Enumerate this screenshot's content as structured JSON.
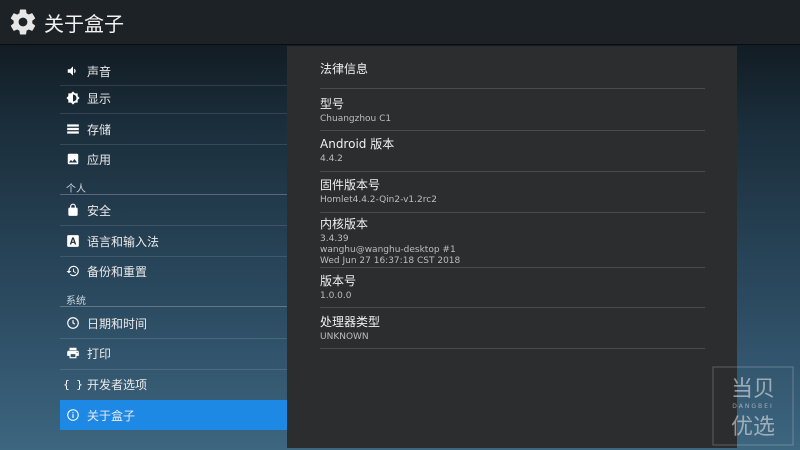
{
  "titlebar": {
    "title": "关于盒子",
    "icon": "gear-icon"
  },
  "sidebar": {
    "items_top": [
      {
        "label": "声音",
        "icon": "speaker-icon"
      },
      {
        "label": "显示",
        "icon": "brightness-icon"
      },
      {
        "label": "存储",
        "icon": "storage-icon"
      },
      {
        "label": "应用",
        "icon": "apps-icon"
      }
    ],
    "section_personal": "个人",
    "items_personal": [
      {
        "label": "安全",
        "icon": "lock-icon"
      },
      {
        "label": "语言和输入法",
        "icon": "keyboard-icon"
      },
      {
        "label": "备份和重置",
        "icon": "restore-icon"
      }
    ],
    "section_system": "系统",
    "items_system": [
      {
        "label": "日期和时间",
        "icon": "clock-icon"
      },
      {
        "label": "打印",
        "icon": "printer-icon"
      },
      {
        "label": "开发者选项",
        "icon": "braces-icon"
      },
      {
        "label": "关于盒子",
        "icon": "info-icon",
        "active": true
      }
    ],
    "active_color": "#1e88e5"
  },
  "about": {
    "legal_label": "法律信息",
    "model": {
      "label": "型号",
      "value": "Chuangzhou C1"
    },
    "android": {
      "label": "Android 版本",
      "value": "4.4.2"
    },
    "firmware": {
      "label": "固件版本号",
      "value": "Homlet4.4.2-Qin2-v1.2rc2"
    },
    "kernel": {
      "label": "内核版本",
      "line1": "3.4.39",
      "line2": "wanghu@wanghu-desktop #1",
      "line3": "Wed Jun 27 16:37:18 CST 2018"
    },
    "build": {
      "label": "版本号",
      "value": "1.0.0.0"
    },
    "processor": {
      "label": "处理器类型",
      "value": "UNKNOWN"
    }
  },
  "watermark": {
    "top": "当贝",
    "mid": "DANGBEI",
    "bottom": "优选"
  }
}
